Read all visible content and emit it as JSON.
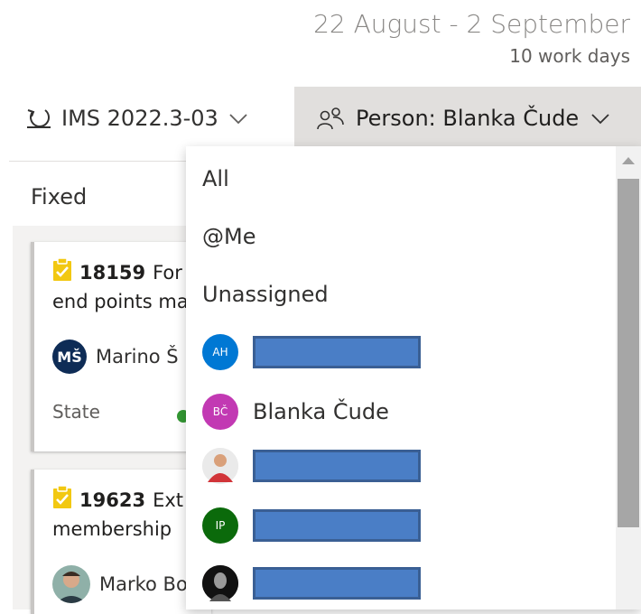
{
  "sprint": {
    "date_range": "22 August - 2 September",
    "work_days": "10 work days"
  },
  "toolbar": {
    "iteration_label": "IMS 2022.3-03",
    "person_filter_label": "Person: Blanka Čude"
  },
  "column": {
    "title": "Fixed"
  },
  "cards": [
    {
      "id": "18159",
      "title_line1": "For",
      "title_line2": "end points ma",
      "assignee_initials": "MŠ",
      "assignee_name": "Marino Š",
      "state_label": "State"
    },
    {
      "id": "19623",
      "title_line1": "Ext",
      "title_line2": "membership",
      "assignee_name": "Marko Bo"
    }
  ],
  "person_menu": {
    "items": [
      {
        "label": "All"
      },
      {
        "label": "@Me"
      },
      {
        "label": "Unassigned"
      }
    ],
    "people": [
      {
        "initials": "AH",
        "avatar_color": "#0078d4",
        "name": ""
      },
      {
        "initials": "BČ",
        "avatar_color": "#c239b3",
        "name": "Blanka Čude"
      },
      {
        "initials": "",
        "avatar_color": "#d13438",
        "name": ""
      },
      {
        "initials": "IP",
        "avatar_color": "#0b6a0b",
        "name": ""
      },
      {
        "initials": "",
        "avatar_color": "#1b1a19",
        "name": ""
      }
    ]
  },
  "colors": {
    "redaction": "#4a7ec6",
    "state_green": "#339933",
    "selected_filter_bg": "#e1dfdd"
  }
}
